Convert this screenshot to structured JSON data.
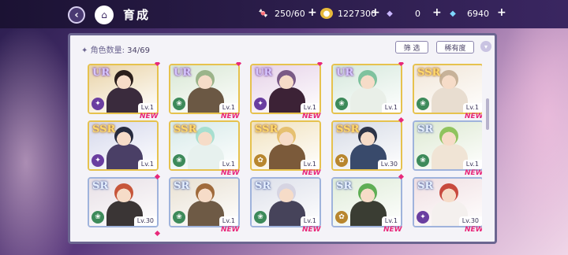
{
  "header": {
    "title": "育成",
    "stamina": "250/60",
    "coins": "1227300",
    "gems_free": "0",
    "gems_paid": "6940"
  },
  "panel": {
    "count_label": "角色数量: ",
    "count_value": "34/69",
    "filter_label": "筛 选",
    "sort_label": "稀有度"
  },
  "cards": [
    {
      "rarity": "UR",
      "level": "Lv.1",
      "new": false,
      "attr": "fire",
      "bg": "#e9d3a7",
      "hair": "#2b1f1c",
      "cloth": "#3a2b3d"
    },
    {
      "rarity": "UR",
      "level": "Lv.1",
      "new": false,
      "attr": "wind",
      "bg": "#d8e7d4",
      "hair": "#9bb48a",
      "cloth": "#6b5844"
    },
    {
      "rarity": "UR",
      "level": "Lv.1",
      "new": false,
      "attr": "fire",
      "bg": "#e6d2e8",
      "hair": "#7a5a86",
      "cloth": "#3c2236"
    },
    {
      "rarity": "UR",
      "level": "Lv.1",
      "new": false,
      "attr": "wind",
      "bg": "#d5e8dc",
      "hair": "#7fc29e",
      "cloth": "#e9efe8"
    },
    {
      "rarity": "SSR",
      "level": "Lv.1",
      "new": true,
      "attr": "wind",
      "bg": "#f1e6d8",
      "hair": "#c7b299",
      "cloth": "#e8ddd0"
    },
    {
      "rarity": "SSR",
      "level": "Lv.1",
      "new": true,
      "attr": "fire",
      "bg": "#d5d8ec",
      "hair": "#262a3e",
      "cloth": "#4a3f66"
    },
    {
      "rarity": "SSR",
      "level": "Lv.1",
      "new": true,
      "attr": "wind",
      "bg": "#d7eae9",
      "hair": "#a7dfd0",
      "cloth": "#e7f1ee"
    },
    {
      "rarity": "SSR",
      "level": "Lv.1",
      "new": true,
      "attr": "earth",
      "bg": "#f1e2be",
      "hair": "#e6c070",
      "cloth": "#7b5a3a"
    },
    {
      "rarity": "SSR",
      "level": "Lv.30",
      "new": false,
      "attr": "earth",
      "bg": "#d6dbe6",
      "hair": "#2d3447",
      "cloth": "#394a6b"
    },
    {
      "rarity": "SR",
      "level": "Lv.1",
      "new": true,
      "attr": "wind",
      "bg": "#dde9d2",
      "hair": "#8fc35e",
      "cloth": "#f0e4d5"
    },
    {
      "rarity": "SR",
      "level": "Lv.30",
      "new": false,
      "attr": "wind",
      "bg": "#e7dfe5",
      "hair": "#c7563b",
      "cloth": "#3a3535"
    },
    {
      "rarity": "SR",
      "level": "Lv.1",
      "new": true,
      "attr": "wind",
      "bg": "#e8e0d2",
      "hair": "#a06b3c",
      "cloth": "#6e5a45"
    },
    {
      "rarity": "SR",
      "level": "Lv.1",
      "new": true,
      "attr": "wind",
      "bg": "#dde0ea",
      "hair": "#d6d4e2",
      "cloth": "#46435a"
    },
    {
      "rarity": "SR",
      "level": "Lv.1",
      "new": false,
      "attr": "earth",
      "bg": "#dfecd8",
      "hair": "#5fae55",
      "cloth": "#3a3d33"
    },
    {
      "rarity": "SR",
      "level": "Lv.30",
      "new": true,
      "attr": "fire",
      "bg": "#f0dfe2",
      "hair": "#c84a3e",
      "cloth": "#f4f0ee"
    }
  ],
  "new_label": "NEW",
  "next_row_new": [
    "NEW",
    "NEW",
    "NEW",
    "NEW"
  ]
}
